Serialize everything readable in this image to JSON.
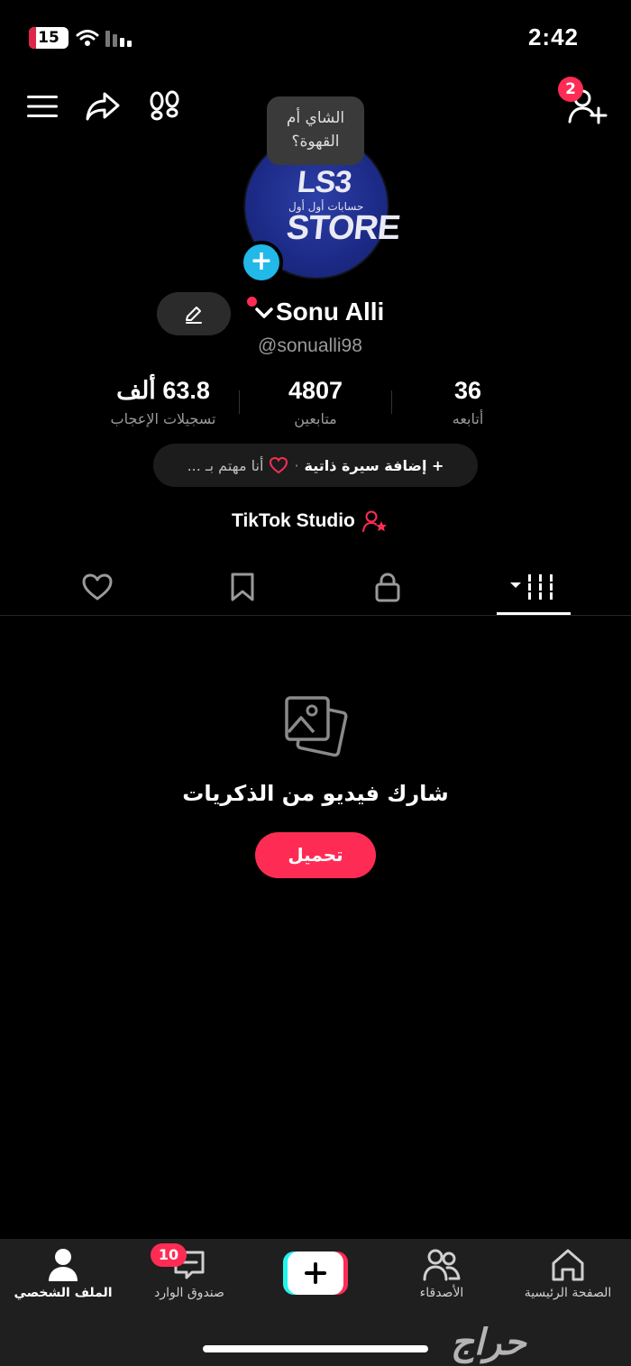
{
  "status_bar": {
    "battery": "15",
    "time": "2:42"
  },
  "header": {
    "friend_requests_badge": "2"
  },
  "avatar": {
    "status_bubble": "الشاي أم القهوة؟",
    "logo_line1": "LS3",
    "logo_line2": "حسابات أول أول",
    "logo_line3": "STORE"
  },
  "profile": {
    "display_name": "Sonu Alli",
    "username": "@sonualli98"
  },
  "stats": [
    {
      "value": "63.8 ألف",
      "label": "تسجيلات الإعجاب"
    },
    {
      "value": "4807",
      "label": "متابعين"
    },
    {
      "value": "36",
      "label": "أتابعه"
    }
  ],
  "bio": {
    "add_bio": "+ إضافة سيرة ذاتية",
    "separator": "·",
    "interest": "أنا مهتم بـ ..."
  },
  "studio": {
    "label": "TikTok Studio"
  },
  "empty_state": {
    "title": "شارك فيديو من الذكريات",
    "upload_button": "تحميل"
  },
  "bottom_nav": {
    "profile": "الملف الشخصي",
    "inbox": "صندوق الوارد",
    "inbox_badge": "10",
    "friends": "الأصدقاء",
    "home": "الصفحة الرئيسية"
  },
  "watermark": "حراج",
  "colors": {
    "accent": "#fe2c55",
    "avatar_add": "#22b8e8",
    "nav_bg": "#1f1f1f"
  }
}
